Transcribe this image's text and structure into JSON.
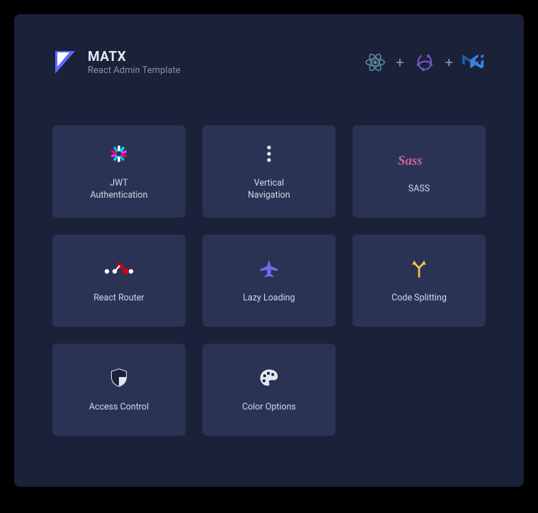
{
  "brand": {
    "title": "MATX",
    "subtitle": "React Admin Template"
  },
  "separator": "+",
  "features": [
    {
      "label": "JWT\nAuthentication",
      "icon": "jwt-icon"
    },
    {
      "label": "Vertical\nNavigation",
      "icon": "vertical-dots-icon"
    },
    {
      "label": "SASS",
      "icon": "sass-icon"
    },
    {
      "label": "React Router",
      "icon": "router-icon"
    },
    {
      "label": "Lazy Loading",
      "icon": "plane-icon"
    },
    {
      "label": "Code Splitting",
      "icon": "split-icon"
    },
    {
      "label": "Access Control",
      "icon": "shield-icon"
    },
    {
      "label": "Color Options",
      "icon": "palette-icon"
    }
  ]
}
